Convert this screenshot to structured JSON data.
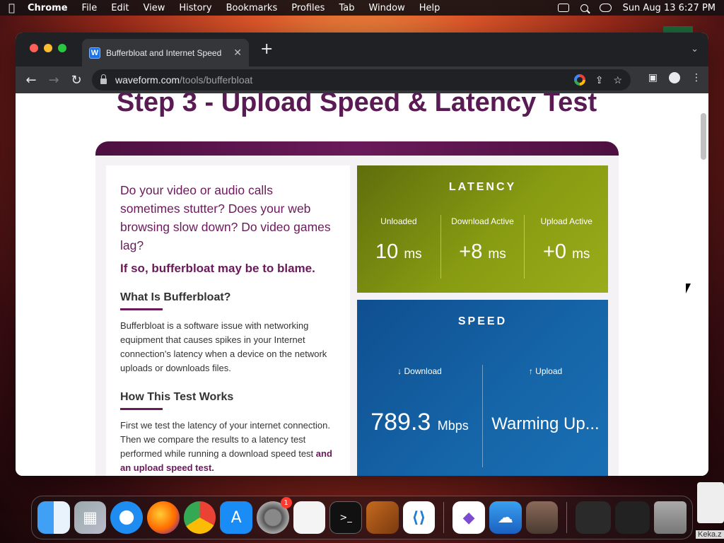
{
  "menubar": {
    "app": "Chrome",
    "items": [
      "File",
      "Edit",
      "View",
      "History",
      "Bookmarks",
      "Profiles",
      "Tab",
      "Window",
      "Help"
    ],
    "datetime": "Sun Aug 13  6:27 PM"
  },
  "browser": {
    "tab_title": "Bufferbloat and Internet Speed",
    "favicon": "W",
    "url_host": "waveform.com",
    "url_path": "/tools/bufferbloat"
  },
  "page": {
    "title": "Step 3 - Upload Speed & Latency Test",
    "lead": "Do your video or audio calls sometimes stutter? Does your web browsing slow down? Do video games lag?",
    "blame": "If so, bufferbloat may be to blame.",
    "section1_heading": "What Is Bufferbloat?",
    "section1_text": "Bufferbloat is a software issue with networking equipment that causes spikes in your Internet connection's latency when a device on the network uploads or downloads files.",
    "section2_heading": "How This Test Works",
    "section2_text": "First we test the latency of your internet connection. Then we compare the results to a latency test performed while running a download speed test ",
    "section2_bold": "and an upload speed test."
  },
  "latency": {
    "title": "LATENCY",
    "columns": [
      {
        "label": "Unloaded",
        "value": "10",
        "unit": "ms"
      },
      {
        "label": "Download Active",
        "value": "+8",
        "unit": "ms"
      },
      {
        "label": "Upload Active",
        "value": "+0",
        "unit": "ms"
      }
    ]
  },
  "speed": {
    "title": "SPEED",
    "download_label": "↓ Download",
    "download_value": "789.3",
    "download_unit": "Mbps",
    "upload_label": "↑ Upload",
    "upload_value": "Warming Up..."
  },
  "dock": {
    "settings_badge": "1",
    "keka_label": "Keka.z"
  }
}
